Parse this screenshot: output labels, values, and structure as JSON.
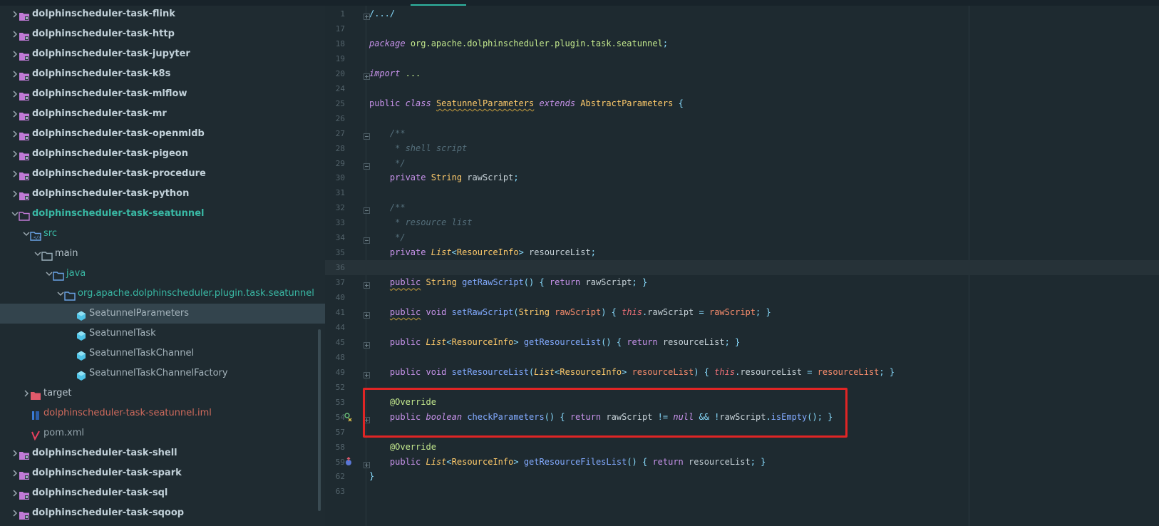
{
  "project_tree": {
    "items": [
      {
        "label": "dolphinscheduler-task-flink",
        "kind": "module",
        "depth": 0,
        "expanded": false
      },
      {
        "label": "dolphinscheduler-task-http",
        "kind": "module",
        "depth": 0,
        "expanded": false
      },
      {
        "label": "dolphinscheduler-task-jupyter",
        "kind": "module",
        "depth": 0,
        "expanded": false
      },
      {
        "label": "dolphinscheduler-task-k8s",
        "kind": "module",
        "depth": 0,
        "expanded": false
      },
      {
        "label": "dolphinscheduler-task-mlflow",
        "kind": "module",
        "depth": 0,
        "expanded": false
      },
      {
        "label": "dolphinscheduler-task-mr",
        "kind": "module",
        "depth": 0,
        "expanded": false
      },
      {
        "label": "dolphinscheduler-task-openmldb",
        "kind": "module",
        "depth": 0,
        "expanded": false
      },
      {
        "label": "dolphinscheduler-task-pigeon",
        "kind": "module",
        "depth": 0,
        "expanded": false
      },
      {
        "label": "dolphinscheduler-task-procedure",
        "kind": "module",
        "depth": 0,
        "expanded": false
      },
      {
        "label": "dolphinscheduler-task-python",
        "kind": "module",
        "depth": 0,
        "expanded": false
      },
      {
        "label": "dolphinscheduler-task-seatunnel",
        "kind": "module-active",
        "depth": 0,
        "expanded": true
      },
      {
        "label": "src",
        "kind": "src-folder",
        "depth": 1,
        "expanded": true
      },
      {
        "label": "main",
        "kind": "folder",
        "depth": 2,
        "expanded": true
      },
      {
        "label": "java",
        "kind": "java-folder",
        "depth": 3,
        "expanded": true
      },
      {
        "label": "org.apache.dolphinscheduler.plugin.task.seatunnel",
        "kind": "package",
        "depth": 4,
        "expanded": true
      },
      {
        "label": "SeatunnelParameters",
        "kind": "class",
        "depth": 5,
        "selected": true
      },
      {
        "label": "SeatunnelTask",
        "kind": "class",
        "depth": 5
      },
      {
        "label": "SeatunnelTaskChannel",
        "kind": "class",
        "depth": 5
      },
      {
        "label": "SeatunnelTaskChannelFactory",
        "kind": "class",
        "depth": 5
      },
      {
        "label": "target",
        "kind": "excluded-folder",
        "depth": 1,
        "expanded": false
      },
      {
        "label": "dolphinscheduler-task-seatunnel.iml",
        "kind": "iml",
        "depth": 1
      },
      {
        "label": "pom.xml",
        "kind": "pom",
        "depth": 1
      },
      {
        "label": "dolphinscheduler-task-shell",
        "kind": "module",
        "depth": 0,
        "expanded": false
      },
      {
        "label": "dolphinscheduler-task-spark",
        "kind": "module",
        "depth": 0,
        "expanded": false
      },
      {
        "label": "dolphinscheduler-task-sql",
        "kind": "module",
        "depth": 0,
        "expanded": false
      },
      {
        "label": "dolphinscheduler-task-sqoop",
        "kind": "module",
        "depth": 0,
        "expanded": false
      }
    ]
  },
  "editor": {
    "current_line": "36",
    "lines": [
      {
        "n": "1",
        "fold": "plus",
        "t": [
          [
            "pu",
            "/.../"
          ]
        ]
      },
      {
        "n": "17",
        "t": []
      },
      {
        "n": "18",
        "t": [
          [
            "kwi",
            "package"
          ],
          [
            "",
            " "
          ],
          [
            "pk",
            "org.apache.dolphinscheduler.plugin.task.seatunnel"
          ],
          [
            "pu",
            ";"
          ]
        ]
      },
      {
        "n": "19",
        "t": []
      },
      {
        "n": "20",
        "fold": "plus",
        "t": [
          [
            "kwi",
            "import"
          ],
          [
            "",
            " "
          ],
          [
            "pk",
            "..."
          ]
        ]
      },
      {
        "n": "24",
        "t": []
      },
      {
        "n": "25",
        "t": [
          [
            "kw",
            "public"
          ],
          [
            "",
            " "
          ],
          [
            "kwi",
            "class"
          ],
          [
            "",
            " "
          ],
          [
            "tyw",
            "SeatunnelParameters"
          ],
          [
            "",
            " "
          ],
          [
            "kwi",
            "extends"
          ],
          [
            "",
            " "
          ],
          [
            "ty",
            "AbstractParameters"
          ],
          [
            "",
            " "
          ],
          [
            "pu",
            "{"
          ]
        ]
      },
      {
        "n": "26",
        "t": []
      },
      {
        "n": "27",
        "fold": "minus",
        "t": [
          [
            "",
            "    "
          ],
          [
            "cm",
            "/**"
          ]
        ]
      },
      {
        "n": "28",
        "t": [
          [
            "",
            "    "
          ],
          [
            "cm",
            " * shell script"
          ]
        ]
      },
      {
        "n": "29",
        "fold": "minus",
        "t": [
          [
            "",
            "    "
          ],
          [
            "cm",
            " */"
          ]
        ]
      },
      {
        "n": "30",
        "t": [
          [
            "",
            "    "
          ],
          [
            "kw",
            "private"
          ],
          [
            "",
            " "
          ],
          [
            "ty",
            "String"
          ],
          [
            "",
            " rawScript"
          ],
          [
            "pu",
            ";"
          ]
        ]
      },
      {
        "n": "31",
        "t": []
      },
      {
        "n": "32",
        "fold": "minus",
        "t": [
          [
            "",
            "    "
          ],
          [
            "cm",
            "/**"
          ]
        ]
      },
      {
        "n": "33",
        "t": [
          [
            "",
            "    "
          ],
          [
            "cm",
            " * resource list"
          ]
        ]
      },
      {
        "n": "34",
        "fold": "minus",
        "t": [
          [
            "",
            "    "
          ],
          [
            "cm",
            " */"
          ]
        ]
      },
      {
        "n": "35",
        "t": [
          [
            "",
            "    "
          ],
          [
            "kw",
            "private"
          ],
          [
            "",
            " "
          ],
          [
            "tyi",
            "List"
          ],
          [
            "pu",
            "<"
          ],
          [
            "ty",
            "ResourceInfo"
          ],
          [
            "pu",
            ">"
          ],
          [
            "",
            " resourceList"
          ],
          [
            "pu",
            ";"
          ]
        ]
      },
      {
        "n": "36",
        "t": []
      },
      {
        "n": "37",
        "fold": "plus",
        "t": [
          [
            "",
            "    "
          ],
          [
            "kww",
            "public"
          ],
          [
            "",
            " "
          ],
          [
            "ty",
            "String"
          ],
          [
            "",
            " "
          ],
          [
            "fn",
            "getRawScript"
          ],
          [
            "pu",
            "() { "
          ],
          [
            "kw",
            "return"
          ],
          [
            "",
            " rawScript"
          ],
          [
            "pu",
            "; }"
          ]
        ]
      },
      {
        "n": "40",
        "t": []
      },
      {
        "n": "41",
        "fold": "plus",
        "t": [
          [
            "",
            "    "
          ],
          [
            "kww",
            "public"
          ],
          [
            "",
            " "
          ],
          [
            "kw",
            "void"
          ],
          [
            "",
            " "
          ],
          [
            "fn",
            "setRawScript"
          ],
          [
            "pu",
            "("
          ],
          [
            "ty",
            "String"
          ],
          [
            "",
            " "
          ],
          [
            "pr",
            "rawScript"
          ],
          [
            "pu",
            ") { "
          ],
          [
            "th",
            "this"
          ],
          [
            "pu",
            "."
          ],
          [
            "",
            "rawScript "
          ],
          [
            "pu",
            "="
          ],
          [
            "",
            " "
          ],
          [
            "pr",
            "rawScript"
          ],
          [
            "pu",
            "; }"
          ]
        ]
      },
      {
        "n": "44",
        "t": []
      },
      {
        "n": "45",
        "fold": "plus",
        "t": [
          [
            "",
            "    "
          ],
          [
            "kw",
            "public"
          ],
          [
            "",
            " "
          ],
          [
            "tyi",
            "List"
          ],
          [
            "pu",
            "<"
          ],
          [
            "ty",
            "ResourceInfo"
          ],
          [
            "pu",
            ">"
          ],
          [
            "",
            " "
          ],
          [
            "fn",
            "getResourceList"
          ],
          [
            "pu",
            "() { "
          ],
          [
            "kw",
            "return"
          ],
          [
            "",
            " resourceList"
          ],
          [
            "pu",
            "; }"
          ]
        ]
      },
      {
        "n": "48",
        "t": []
      },
      {
        "n": "49",
        "fold": "plus",
        "t": [
          [
            "",
            "    "
          ],
          [
            "kw",
            "public"
          ],
          [
            "",
            " "
          ],
          [
            "kw",
            "void"
          ],
          [
            "",
            " "
          ],
          [
            "fn",
            "setResourceList"
          ],
          [
            "pu",
            "("
          ],
          [
            "tyi",
            "List"
          ],
          [
            "pu",
            "<"
          ],
          [
            "ty",
            "ResourceInfo"
          ],
          [
            "pu",
            ">"
          ],
          [
            "",
            " "
          ],
          [
            "pr",
            "resourceList"
          ],
          [
            "pu",
            ") { "
          ],
          [
            "th",
            "this"
          ],
          [
            "pu",
            "."
          ],
          [
            "",
            "resourceList "
          ],
          [
            "pu",
            "="
          ],
          [
            "",
            " "
          ],
          [
            "pr",
            "resourceList"
          ],
          [
            "pu",
            "; }"
          ]
        ]
      },
      {
        "n": "52",
        "t": []
      },
      {
        "n": "53",
        "t": [
          [
            "",
            "    "
          ],
          [
            "an",
            "@Override"
          ]
        ]
      },
      {
        "n": "54",
        "fold": "plus",
        "gicon": "implementing-method-icon",
        "t": [
          [
            "",
            "    "
          ],
          [
            "kw",
            "public"
          ],
          [
            "",
            " "
          ],
          [
            "kwi",
            "boolean"
          ],
          [
            "",
            " "
          ],
          [
            "fn",
            "checkParameters"
          ],
          [
            "pu",
            "() { "
          ],
          [
            "kw",
            "return"
          ],
          [
            "",
            " rawScript "
          ],
          [
            "pu",
            "!="
          ],
          [
            "",
            " "
          ],
          [
            "kwi",
            "null"
          ],
          [
            "",
            " "
          ],
          [
            "pu",
            "&&"
          ],
          [
            "",
            " "
          ],
          [
            "pu",
            "!"
          ],
          [
            "",
            "rawScript"
          ],
          [
            "pu",
            "."
          ],
          [
            "fn",
            "isEmpty"
          ],
          [
            "pu",
            "(); }"
          ]
        ]
      },
      {
        "n": "57",
        "t": []
      },
      {
        "n": "58",
        "t": [
          [
            "",
            "    "
          ],
          [
            "an",
            "@Override"
          ]
        ]
      },
      {
        "n": "59",
        "fold": "plus",
        "gicon": "override-method-icon",
        "t": [
          [
            "",
            "    "
          ],
          [
            "kw",
            "public"
          ],
          [
            "",
            " "
          ],
          [
            "tyi",
            "List"
          ],
          [
            "pu",
            "<"
          ],
          [
            "ty",
            "ResourceInfo"
          ],
          [
            "pu",
            ">"
          ],
          [
            "",
            " "
          ],
          [
            "fn",
            "getResourceFilesList"
          ],
          [
            "pu",
            "() { "
          ],
          [
            "kw",
            "return"
          ],
          [
            "",
            " resourceList"
          ],
          [
            "pu",
            "; }"
          ]
        ]
      },
      {
        "n": "62",
        "t": [
          [
            "pu",
            "}"
          ]
        ]
      },
      {
        "n": "63",
        "t": []
      }
    ]
  },
  "colors": {
    "highlight_box": "#e02525",
    "active_module": "#39b8a4",
    "selected_row": "#33444d"
  }
}
